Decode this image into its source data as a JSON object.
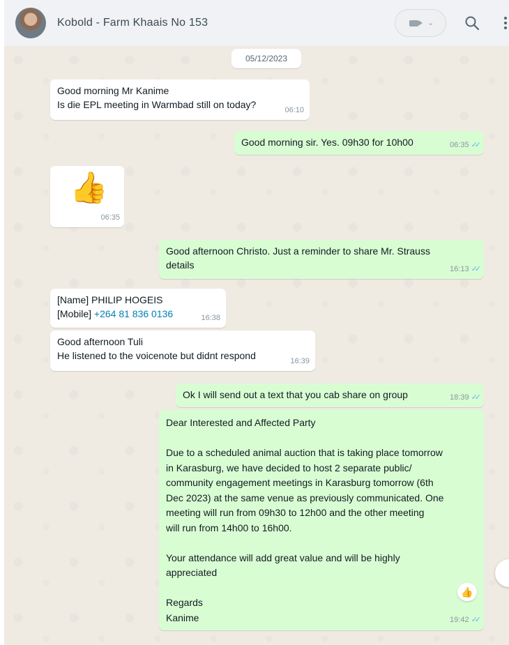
{
  "header": {
    "contact_name": "Kobold - Farm Khaais No 153",
    "icons": [
      "video-camera-icon",
      "chevron-down-icon",
      "search-icon",
      "menu-icon"
    ]
  },
  "chat": {
    "date": "05/12/2023",
    "messages": [
      {
        "direction": "in",
        "lines": [
          "Good morning Mr Kanime",
          "Is die EPL meeting in Warmbad still on today?"
        ],
        "time": "06:10"
      },
      {
        "direction": "out",
        "lines": [
          "Good morning sir. Yes. 09h30 for 10h00"
        ],
        "time": "06:35",
        "status": "read"
      },
      {
        "direction": "in",
        "sticker": "thumbs-up-emoji",
        "time": "06:35"
      },
      {
        "direction": "out",
        "lines": [
          "Good afternoon Christo. Just a reminder to share Mr. Strauss",
          "details"
        ],
        "time": "16:13",
        "status": "read"
      },
      {
        "direction": "in",
        "contact_card": {
          "name_label": "[Name]",
          "name": "PHILIP HOGEIS",
          "mobile_label": "[Mobile]",
          "mobile": "+264 81 836 0136"
        },
        "time": "16:38"
      },
      {
        "direction": "in",
        "lines": [
          "Good afternoon Tuli",
          "He listened to the voicenote but didnt respond"
        ],
        "time": "16:39"
      },
      {
        "direction": "out",
        "lines": [
          "Ok I will send out a text that you cab share on group"
        ],
        "time": "18:39",
        "status": "read"
      },
      {
        "direction": "out",
        "lines": [
          "Dear Interested and Affected Party",
          "",
          "Due to a scheduled animal auction that is taking place tomorrow",
          "in Karasburg, we have decided to host 2 separate public/",
          "community engagement meetings in Karasburg tomorrow (6th",
          "Dec 2023) at the same venue as previously communicated. One",
          "meeting will run from 09h30 to 12h00 and the other meeting",
          "will run from 14h00 to 16h00.",
          "",
          "Your attendance will add great value and will be highly",
          "appreciated",
          "",
          "Regards",
          "Kanime"
        ],
        "time": "19:42",
        "status": "read",
        "reaction": "thumbs-up-emoji"
      }
    ]
  },
  "colors": {
    "incoming": "#ffffff",
    "outgoing": "#d9fdd3",
    "read_ticks": "#53bdeb",
    "chat_bg": "#efeae2"
  }
}
